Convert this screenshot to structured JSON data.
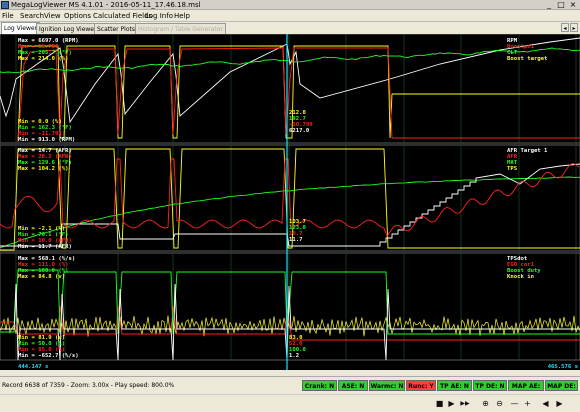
{
  "window": {
    "title": "MegaLogViewer MS 4.1.01 - 2016-05-11_17.46.18.msl",
    "minimize": "_",
    "maximize": "□",
    "close": "×"
  },
  "menu": [
    "File",
    "Search",
    "View",
    "Options",
    "Calculated Fields",
    "Log Info",
    "Help"
  ],
  "tabs": [
    {
      "label": "Log Viewer",
      "active": true
    },
    {
      "label": "Ignition Log Viewer"
    },
    {
      "label": "Scatter Plots"
    },
    {
      "label": "Histogram / Table Generator",
      "disabled": true
    }
  ],
  "tab_arrows": [
    "◂",
    "▸"
  ],
  "chart_data": [
    {
      "type": "line",
      "panel": 1,
      "legend": [
        {
          "name": "RPM",
          "color": "#ffffff"
        },
        {
          "name": "Boostpsi",
          "color": "#ff2020"
        },
        {
          "name": "CLT",
          "color": "#20ff20"
        },
        {
          "name": "Boost target",
          "color": "#ffff20"
        }
      ],
      "max": [
        "Max = 6697.0 (RPM)",
        "Max = 15.700",
        "Max = 205.7 (°F)",
        "Max = 214.0 (%)"
      ],
      "min": [
        "Min = 0.0 (%)",
        "Min = 162.3 (°F)",
        "Min = -11.793",
        "Min = 913.0 (RPM)"
      ],
      "cursor": [
        "212.0",
        "192.7",
        "-10.799",
        "6217.0"
      ]
    },
    {
      "type": "line",
      "panel": 2,
      "legend": [
        {
          "name": "AFR Target 1",
          "color": "#ffffff"
        },
        {
          "name": "AFR",
          "color": "#ff2020"
        },
        {
          "name": "MAT",
          "color": "#20ff20"
        },
        {
          "name": "TPS",
          "color": "#ffff20"
        }
      ],
      "max": [
        "Max = 14.7 (AFR)",
        "Max = 20.2 (AFR)",
        "Max = 129.6 (°F)",
        "Max = 104.2 (%)"
      ],
      "min": [
        "Min = -2.1 (%)",
        "Min = 76.1 (°F)",
        "Min = 10.0 (AFR)",
        "Min = 11.7 (AFR)"
      ],
      "cursor": [
        "103.7",
        "123.0",
        "10.7",
        "11.7"
      ]
    },
    {
      "type": "line",
      "panel": 3,
      "legend": [
        {
          "name": "TPSdot",
          "color": "#ffffff"
        },
        {
          "name": "EGO cor1",
          "color": "#ff2020"
        },
        {
          "name": "Boost duty",
          "color": "#20ff20"
        },
        {
          "name": "Knock in",
          "color": "#ffff20"
        }
      ],
      "max": [
        "Max = 568.1 (%/s)",
        "Max = 111.0 (%)",
        "Max = 100.0 (%)",
        "Max = 84.8 (v)"
      ],
      "min": [
        "Min = 81.9 (v)",
        "Min = 50.0 (%)",
        "Min = 85.0 (%)",
        "Min = -652.7 (%/s)"
      ],
      "cursor": [
        "83.0",
        "52.0",
        "100.0",
        "1.2"
      ]
    }
  ],
  "time_left": "444.147 s",
  "time_right": "465.576 s",
  "status": {
    "text": "Record 6638 of 7359 - Zoom: 3.00x - Play speed: 800.0%",
    "indicators": [
      {
        "label": "Crank: N",
        "color": "#33cc33"
      },
      {
        "label": "ASE: N",
        "color": "#33cc33"
      },
      {
        "label": "Warmc: N",
        "color": "#33cc33"
      },
      {
        "label": "Runc: Y",
        "color": "#ff4040"
      },
      {
        "label": "TP AE: N",
        "color": "#33cc33"
      },
      {
        "label": "TP DE: N",
        "color": "#33cc33"
      },
      {
        "label": "MAP AE: N",
        "color": "#33cc33"
      },
      {
        "label": "MAP DE: N",
        "color": "#33cc33"
      }
    ]
  },
  "playback": {
    "buttons": [
      {
        "name": "stop-icon",
        "glyph": "■"
      },
      {
        "name": "play-icon",
        "glyph": "▶"
      },
      {
        "name": "fast-forward-icon",
        "glyph": "▶▶"
      },
      {
        "name": "zoom-in-icon",
        "glyph": "⊕"
      },
      {
        "name": "zoom-out-icon",
        "glyph": "⊖"
      },
      {
        "name": "minus-icon",
        "glyph": "—"
      },
      {
        "name": "plus-icon",
        "glyph": "+"
      },
      {
        "name": "step-back-icon",
        "glyph": "◀"
      },
      {
        "name": "step-forward-icon",
        "glyph": "▶"
      }
    ]
  }
}
